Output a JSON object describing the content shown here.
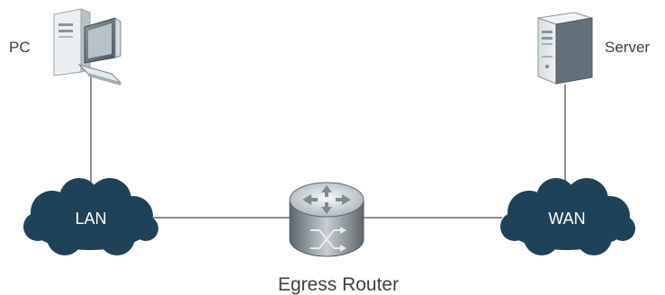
{
  "diagram": {
    "nodes": {
      "pc": {
        "label": "PC",
        "icon": "desktop-computer-icon"
      },
      "server": {
        "label": "Server",
        "icon": "tower-server-icon"
      },
      "lan": {
        "label": "LAN",
        "icon": "cloud-icon"
      },
      "wan": {
        "label": "WAN",
        "icon": "cloud-icon"
      },
      "router": {
        "label": "Egress Router",
        "icon": "router-icon"
      }
    },
    "links": [
      {
        "from": "pc",
        "to": "lan"
      },
      {
        "from": "lan",
        "to": "router"
      },
      {
        "from": "router",
        "to": "wan"
      },
      {
        "from": "wan",
        "to": "server"
      }
    ],
    "colors": {
      "cloud": "#1f4259",
      "line": "#8f8f8f",
      "label": "#3f3f3f",
      "device_light": "#e8ecef",
      "device_dark": "#6f7a82"
    }
  }
}
